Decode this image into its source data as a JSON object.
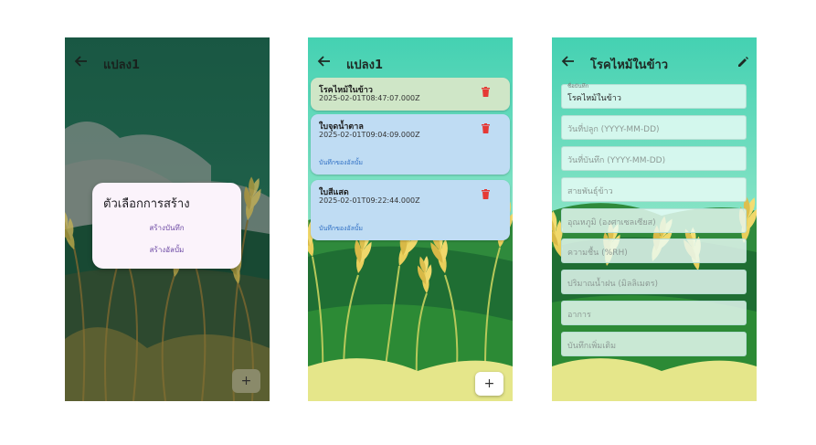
{
  "screen1": {
    "title": "แปลง1",
    "dialog": {
      "title": "ตัวเลือกการสร้าง",
      "options": [
        "สร้างบันทึก",
        "สร้างอัลบั้ม"
      ]
    },
    "fab_label": "+"
  },
  "screen2": {
    "title": "แปลง1",
    "cards": [
      {
        "name": "โรคไหม้ในข้าว",
        "date": "2025-02-01T08:47:07.000Z",
        "link": ""
      },
      {
        "name": "ใบจุดน้ำตาล",
        "date": "2025-02-01T09:04:09.000Z",
        "link": "บันทึกของอัลบั้ม"
      },
      {
        "name": "ใบสีแสด",
        "date": "2025-02-01T09:22:44.000Z",
        "link": "บันทึกของอัลบั้ม"
      }
    ],
    "fab_label": "+"
  },
  "screen3": {
    "title": "โรคไหม้ในข้าว",
    "fields": [
      {
        "label": "ชื่อบันทึก",
        "text": "โรคไหม้ในข้าว",
        "filled": true
      },
      {
        "label": "",
        "text": "วันที่ปลูก (YYYY-MM-DD)",
        "filled": false
      },
      {
        "label": "",
        "text": "วันที่บันทึก (YYYY-MM-DD)",
        "filled": false
      },
      {
        "label": "",
        "text": "สายพันธุ์ข้าว",
        "filled": false
      },
      {
        "label": "",
        "text": "อุณหภูมิ (องศาเซลเซียส)",
        "filled": false
      },
      {
        "label": "",
        "text": "ความชื้น (%RH)",
        "filled": false
      },
      {
        "label": "",
        "text": "ปริมาณน้ำฝน (มิลลิเมตร)",
        "filled": false
      },
      {
        "label": "",
        "text": "อาการ",
        "filled": false
      },
      {
        "label": "",
        "text": "บันทึกเพิ่มเติม",
        "filled": false
      }
    ]
  },
  "icons": {
    "back": "arrow-left-icon",
    "delete": "trash-icon",
    "edit": "pencil-icon",
    "add": "plus-icon"
  },
  "colors": {
    "delete_red": "#e53935",
    "card_green": "#cfe6c7",
    "card_blue": "#bfdcf3",
    "dialog_bg": "#fbf3fb",
    "link_blue": "#2f6fc4"
  }
}
